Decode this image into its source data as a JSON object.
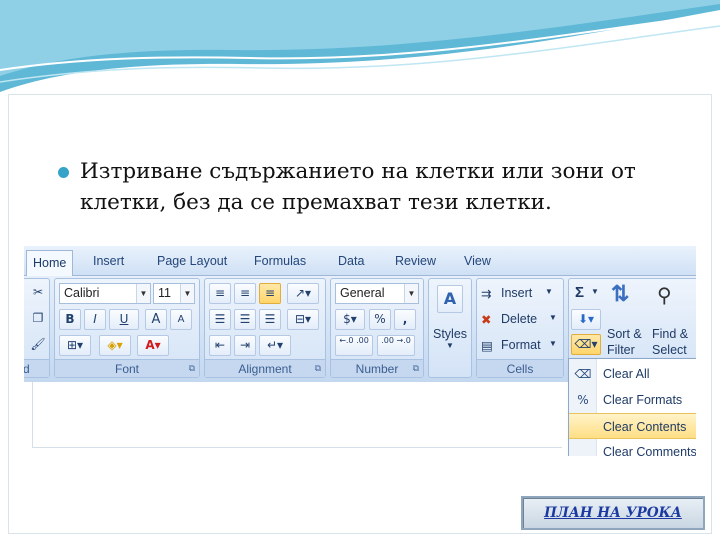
{
  "slide": {
    "bullet_text": "Изтриване съдържанието на клетки или зони от клетки, без да се премахват тези клетки.",
    "lesson_plan_button": "ПЛАН НА УРОКА",
    "accent_color": "#36a3c9"
  },
  "ribbon": {
    "tabs": [
      {
        "label": "Home",
        "active": true
      },
      {
        "label": "Insert"
      },
      {
        "label": "Page Layout"
      },
      {
        "label": "Formulas"
      },
      {
        "label": "Data"
      },
      {
        "label": "Review"
      },
      {
        "label": "View"
      }
    ],
    "groups": {
      "font": {
        "label": "Font",
        "font_name": "Calibri",
        "font_size": "11",
        "bold": "B",
        "italic": "I",
        "underline": "U",
        "grow": "A",
        "shrink": "A"
      },
      "alignment": {
        "label": "Alignment"
      },
      "number": {
        "label": "Number",
        "format": "General",
        "percent": "%",
        "comma": ",",
        "inc_decimal": "←.0 .00",
        "dec_decimal": ".00 →.0"
      },
      "styles": {
        "label": "Styles"
      },
      "cells": {
        "label": "Cells",
        "insert": "Insert",
        "delete": "Delete",
        "format": "Format"
      },
      "editing": {
        "sort_filter_1": "Sort &",
        "sort_filter_2": "Filter",
        "find_select_1": "Find &",
        "find_select_2": "Select"
      },
      "clipboard_partial": {
        "label": "d"
      }
    }
  },
  "clear_menu": {
    "items": [
      {
        "label": "Clear All",
        "icon": "eraser-icon"
      },
      {
        "label": "Clear Formats",
        "icon": "clear-formats-icon"
      },
      {
        "label": "Clear Contents",
        "icon": "clear-contents-icon",
        "highlighted": true
      },
      {
        "label": "Clear Comments",
        "icon": "clear-comments-icon"
      }
    ]
  }
}
